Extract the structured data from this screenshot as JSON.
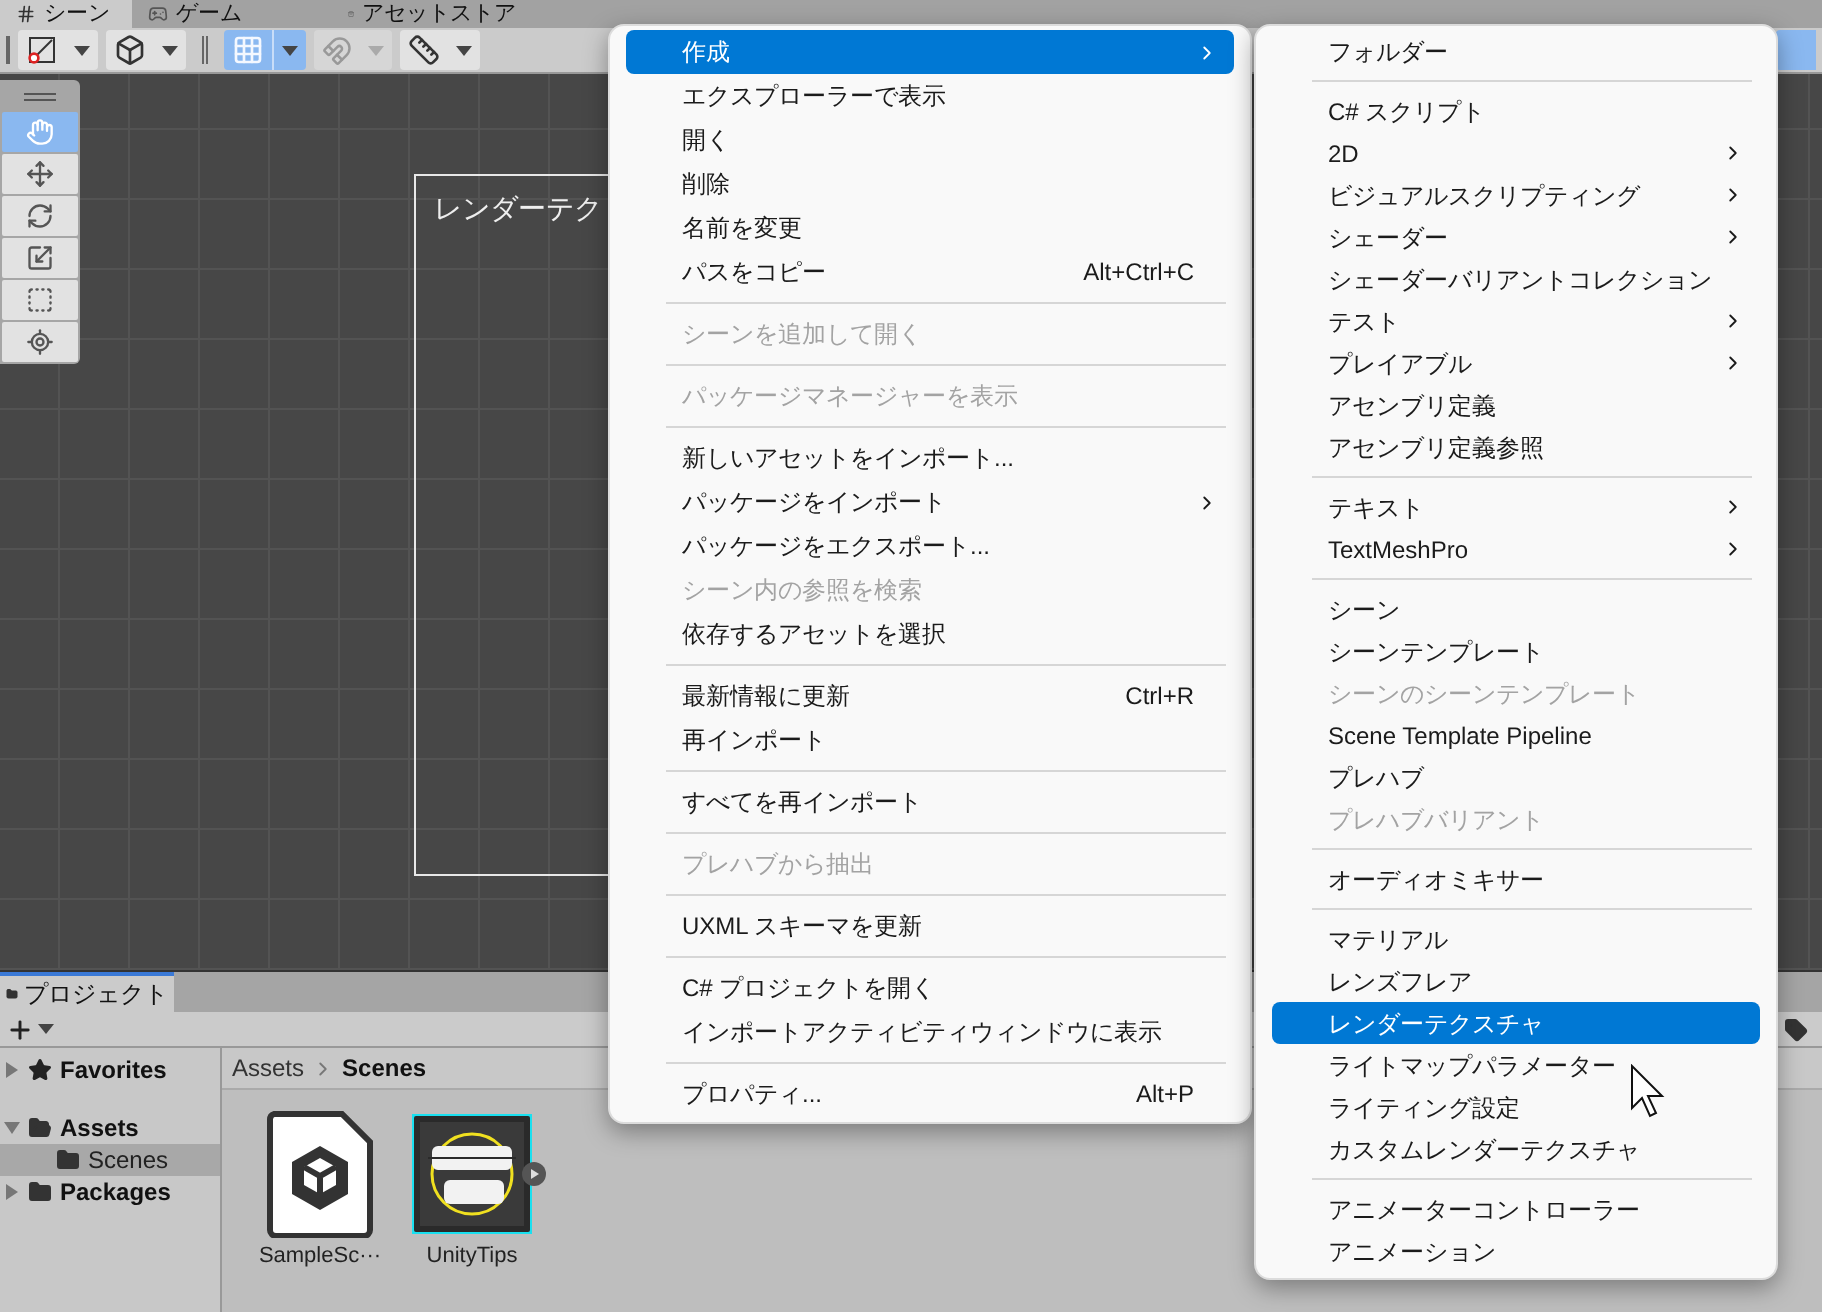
{
  "scene_tabs": [
    {
      "label": "シーン",
      "selected": true
    },
    {
      "label": "ゲーム",
      "selected": false
    },
    {
      "label": "アセットストア",
      "selected": false
    }
  ],
  "toolbar": [
    {
      "kind": "draw-mode",
      "on": false,
      "disabled": false
    },
    {
      "kind": "shading",
      "on": false,
      "disabled": false
    },
    {
      "kind": "grid",
      "on": true,
      "disabled": false
    },
    {
      "kind": "snap",
      "on": false,
      "disabled": true
    },
    {
      "kind": "ruler",
      "on": false,
      "disabled": false
    }
  ],
  "tools": [
    {
      "kind": "hand",
      "selected": true
    },
    {
      "kind": "move",
      "selected": false
    },
    {
      "kind": "rotate",
      "selected": false
    },
    {
      "kind": "scale",
      "selected": false
    },
    {
      "kind": "rect",
      "selected": false
    },
    {
      "kind": "transform",
      "selected": false
    }
  ],
  "scene_view": {
    "object_label": "レンダーテク"
  },
  "project_panel": {
    "tab": "プロジェクト",
    "tree": [
      {
        "label": "Favorites",
        "kind": "favorites",
        "expanded": false,
        "selected": false
      },
      {
        "label": "Assets",
        "kind": "folder",
        "expanded": true,
        "selected": false,
        "children": [
          {
            "label": "Scenes",
            "kind": "folder",
            "expanded": false,
            "selected": true
          }
        ]
      },
      {
        "label": "Packages",
        "kind": "folder",
        "expanded": false,
        "selected": false
      }
    ],
    "breadcrumb": [
      "Assets",
      "Scenes"
    ],
    "assets": [
      {
        "name": "SampleSc···",
        "kind": "scene"
      },
      {
        "name": "UnityTips",
        "kind": "picture"
      }
    ]
  },
  "context_menu": {
    "items": [
      {
        "kind": "item",
        "label": "作成",
        "disabled": false,
        "selected": true,
        "submenu": true
      },
      {
        "kind": "item",
        "label": "エクスプローラーで表示",
        "disabled": false,
        "selected": false,
        "submenu": false
      },
      {
        "kind": "item",
        "label": "開く",
        "disabled": false,
        "selected": false,
        "submenu": false
      },
      {
        "kind": "item",
        "label": "削除",
        "disabled": false,
        "selected": false,
        "submenu": false
      },
      {
        "kind": "item",
        "label": "名前を変更",
        "disabled": false,
        "selected": false,
        "submenu": false
      },
      {
        "kind": "item",
        "label": "パスをコピー",
        "shortcut": "Alt+Ctrl+C",
        "disabled": false,
        "selected": false,
        "submenu": false
      },
      {
        "kind": "separator"
      },
      {
        "kind": "item",
        "label": "シーンを追加して開く",
        "disabled": true,
        "selected": false,
        "submenu": false
      },
      {
        "kind": "separator"
      },
      {
        "kind": "item",
        "label": "パッケージマネージャーを表示",
        "disabled": true,
        "selected": false,
        "submenu": false
      },
      {
        "kind": "separator"
      },
      {
        "kind": "item",
        "label": "新しいアセットをインポート...",
        "disabled": false,
        "selected": false,
        "submenu": false
      },
      {
        "kind": "item",
        "label": "パッケージをインポート",
        "disabled": false,
        "selected": false,
        "submenu": true
      },
      {
        "kind": "item",
        "label": "パッケージをエクスポート...",
        "disabled": false,
        "selected": false,
        "submenu": false
      },
      {
        "kind": "item",
        "label": "シーン内の参照を検索",
        "disabled": true,
        "selected": false,
        "submenu": false
      },
      {
        "kind": "item",
        "label": "依存するアセットを選択",
        "disabled": false,
        "selected": false,
        "submenu": false
      },
      {
        "kind": "separator"
      },
      {
        "kind": "item",
        "label": "最新情報に更新",
        "shortcut": "Ctrl+R",
        "disabled": false,
        "selected": false,
        "submenu": false
      },
      {
        "kind": "item",
        "label": "再インポート",
        "disabled": false,
        "selected": false,
        "submenu": false
      },
      {
        "kind": "separator"
      },
      {
        "kind": "item",
        "label": "すべてを再インポート",
        "disabled": false,
        "selected": false,
        "submenu": false
      },
      {
        "kind": "separator"
      },
      {
        "kind": "item",
        "label": "プレハブから抽出",
        "disabled": true,
        "selected": false,
        "submenu": false
      },
      {
        "kind": "separator"
      },
      {
        "kind": "item",
        "label": "UXML スキーマを更新",
        "disabled": false,
        "selected": false,
        "submenu": false
      },
      {
        "kind": "separator"
      },
      {
        "kind": "item",
        "label": "C# プロジェクトを開く",
        "disabled": false,
        "selected": false,
        "submenu": false
      },
      {
        "kind": "item",
        "label": "インポートアクティビティウィンドウに表示",
        "disabled": false,
        "selected": false,
        "submenu": false
      },
      {
        "kind": "separator"
      },
      {
        "kind": "item",
        "label": "プロパティ...",
        "shortcut": "Alt+P",
        "disabled": false,
        "selected": false,
        "submenu": false
      }
    ]
  },
  "submenu": {
    "items": [
      {
        "kind": "item",
        "label": "フォルダー",
        "disabled": false,
        "selected": false,
        "submenu": false
      },
      {
        "kind": "separator"
      },
      {
        "kind": "item",
        "label": "C# スクリプト",
        "disabled": false,
        "selected": false,
        "submenu": false
      },
      {
        "kind": "item",
        "label": "2D",
        "disabled": false,
        "selected": false,
        "submenu": true
      },
      {
        "kind": "item",
        "label": "ビジュアルスクリプティング",
        "disabled": false,
        "selected": false,
        "submenu": true
      },
      {
        "kind": "item",
        "label": "シェーダー",
        "disabled": false,
        "selected": false,
        "submenu": true
      },
      {
        "kind": "item",
        "label": "シェーダーバリアントコレクション",
        "disabled": false,
        "selected": false,
        "submenu": false
      },
      {
        "kind": "item",
        "label": "テスト",
        "disabled": false,
        "selected": false,
        "submenu": true
      },
      {
        "kind": "item",
        "label": "プレイアブル",
        "disabled": false,
        "selected": false,
        "submenu": true
      },
      {
        "kind": "item",
        "label": "アセンブリ定義",
        "disabled": false,
        "selected": false,
        "submenu": false
      },
      {
        "kind": "item",
        "label": "アセンブリ定義参照",
        "disabled": false,
        "selected": false,
        "submenu": false
      },
      {
        "kind": "separator"
      },
      {
        "kind": "item",
        "label": "テキスト",
        "disabled": false,
        "selected": false,
        "submenu": true
      },
      {
        "kind": "item",
        "label": "TextMeshPro",
        "disabled": false,
        "selected": false,
        "submenu": true
      },
      {
        "kind": "separator"
      },
      {
        "kind": "item",
        "label": "シーン",
        "disabled": false,
        "selected": false,
        "submenu": false
      },
      {
        "kind": "item",
        "label": "シーンテンプレート",
        "disabled": false,
        "selected": false,
        "submenu": false
      },
      {
        "kind": "item",
        "label": "シーンのシーンテンプレート",
        "disabled": true,
        "selected": false,
        "submenu": false
      },
      {
        "kind": "item",
        "label": "Scene Template Pipeline",
        "disabled": false,
        "selected": false,
        "submenu": false
      },
      {
        "kind": "item",
        "label": "プレハブ",
        "disabled": false,
        "selected": false,
        "submenu": false
      },
      {
        "kind": "item",
        "label": "プレハブバリアント",
        "disabled": true,
        "selected": false,
        "submenu": false
      },
      {
        "kind": "separator"
      },
      {
        "kind": "item",
        "label": "オーディオミキサー",
        "disabled": false,
        "selected": false,
        "submenu": false
      },
      {
        "kind": "separator"
      },
      {
        "kind": "item",
        "label": "マテリアル",
        "disabled": false,
        "selected": false,
        "submenu": false
      },
      {
        "kind": "item",
        "label": "レンズフレア",
        "disabled": false,
        "selected": false,
        "submenu": false
      },
      {
        "kind": "item",
        "label": "レンダーテクスチャ",
        "disabled": false,
        "selected": true,
        "submenu": false
      },
      {
        "kind": "item",
        "label": "ライトマップパラメーター",
        "disabled": false,
        "selected": false,
        "submenu": false
      },
      {
        "kind": "item",
        "label": "ライティング設定",
        "disabled": false,
        "selected": false,
        "submenu": false
      },
      {
        "kind": "item",
        "label": "カスタムレンダーテクスチャ",
        "disabled": false,
        "selected": false,
        "submenu": false
      },
      {
        "kind": "separator"
      },
      {
        "kind": "item",
        "label": "アニメーターコントローラー",
        "disabled": false,
        "selected": false,
        "submenu": false
      },
      {
        "kind": "item",
        "label": "アニメーション",
        "disabled": false,
        "selected": false,
        "submenu": false
      }
    ]
  }
}
